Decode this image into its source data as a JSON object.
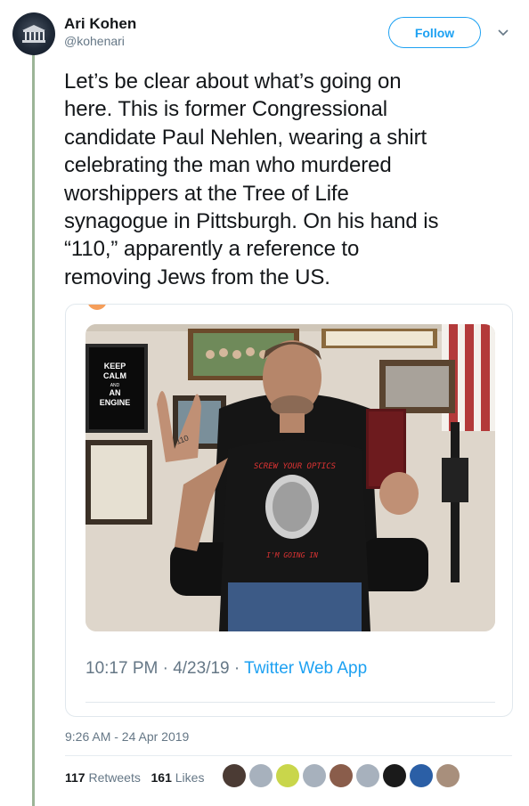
{
  "author": {
    "name": "Ari Kohen",
    "handle": "@kohenari"
  },
  "follow_label": "Follow",
  "tweet_text": "Let’s be clear about what’s going on\nhere. This is former Congressional\ncandidate Paul Nehlen, wearing a shirt\ncelebrating the man who murdered\nworshippers at the Tree of Life\nsynagogue in Pittsburgh. On his hand is\n“110,” apparently a reference to\nremoving Jews from the US.",
  "embedded": {
    "time": "10:17 PM · 4/23/19 · ",
    "app": "Twitter Web App",
    "photo": {
      "poster_text": [
        "KEEP",
        "CALM",
        "AND",
        "AN",
        "ENGINE"
      ],
      "hand_text": "110",
      "shirt_top": "SCREW YOUR OPTICS",
      "shirt_bottom": "I'M GOING IN"
    }
  },
  "timestamp": "9:26 AM - 24 Apr 2019",
  "stats": {
    "retweets_count": "117",
    "retweets_label": "Retweets",
    "likes_count": "161",
    "likes_label": "Likes"
  },
  "colors": {
    "accent": "#1da1f2",
    "muted": "#657786",
    "thread": "#9cb597"
  },
  "likers": [
    "liker-avatar",
    "liker-avatar",
    "liker-avatar",
    "liker-avatar",
    "liker-avatar",
    "liker-avatar",
    "liker-avatar",
    "liker-avatar",
    "liker-avatar",
    "liker-avatar"
  ]
}
